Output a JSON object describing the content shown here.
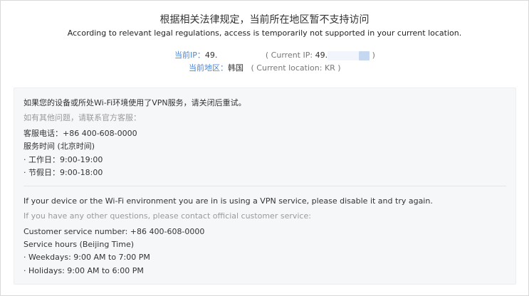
{
  "header": {
    "title_zh": "根据相关法律规定，当前所在地区暂不支持访问",
    "title_en": "According to relevant legal regulations, access is temporarily not supported in your current location."
  },
  "ip": {
    "label_zh": "当前IP：",
    "value": "49.",
    "paren_open": "( Current IP: ",
    "value_en": "49.",
    "paren_close": ")"
  },
  "location": {
    "label_zh": "当前地区：",
    "value_zh": "韩国",
    "paren_en": "( Current location: KR )"
  },
  "notice_zh": {
    "vpn": "如果您的设备或所处Wi-Fi环境使用了VPN服务，请关闭后重试。",
    "contact_hint": "如有其他问题，请联系官方客服：",
    "phone": "客服电话：+86 400-608-0000",
    "hours_title": "服务时间 (北京时间)",
    "weekdays": "· 工作日：9:00-19:00",
    "holidays": "· 节假日：9:00-18:00"
  },
  "notice_en": {
    "vpn": "If your device or the Wi-Fi environment you are in is using a VPN service, please disable it and try again.",
    "contact_hint": "If you have any other questions, please contact official customer service:",
    "phone": "Customer service number: +86 400-608-0000",
    "hours_title": "Service hours (Beijing Time)",
    "weekdays": "· Weekdays: 9:00 AM to 7:00 PM",
    "holidays": "· Holidays: 9:00 AM to 6:00 PM"
  }
}
